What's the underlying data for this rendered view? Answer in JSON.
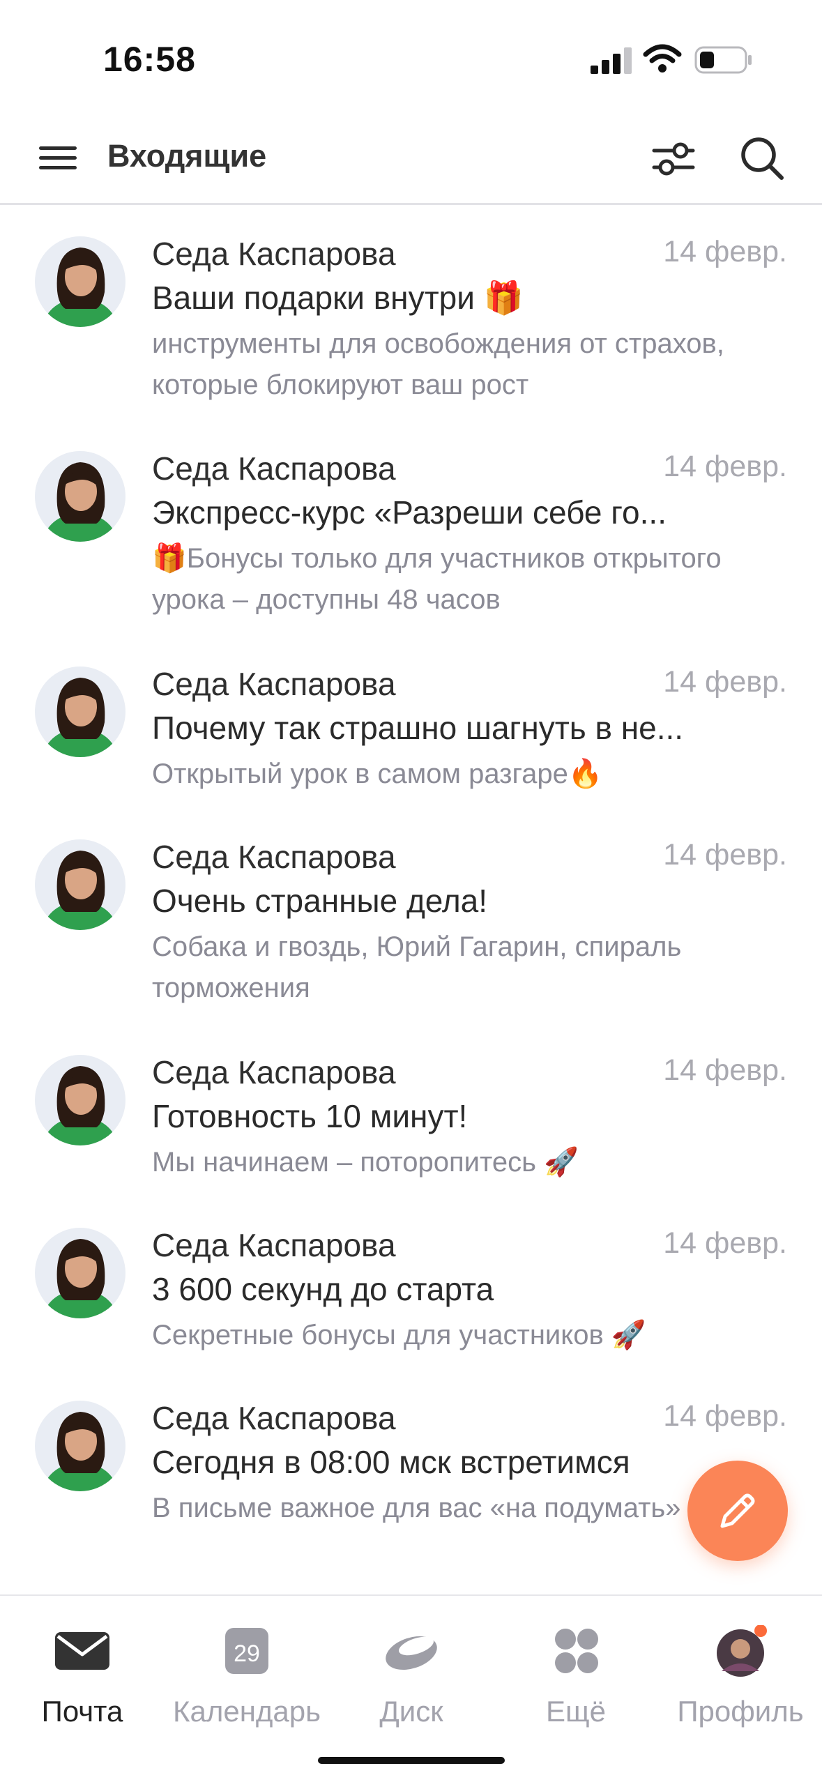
{
  "status_bar": {
    "time": "16:58"
  },
  "header": {
    "title": "Входящие"
  },
  "mails": [
    {
      "sender": "Седа Каспарова",
      "date": "14 февр.",
      "subject": "Ваши подарки внутри 🎁",
      "preview": "инструменты для освобождения от страхов, которые блокируют ваш рост"
    },
    {
      "sender": "Седа Каспарова",
      "date": "14 февр.",
      "subject": "Экспресс-курс «Разреши себе го...",
      "preview": "🎁Бонусы только для участников открытого урока – доступны 48 часов"
    },
    {
      "sender": "Седа Каспарова",
      "date": "14 февр.",
      "subject": "Почему так страшно шагнуть в не...",
      "preview": "Открытый урок в самом разгаре🔥"
    },
    {
      "sender": "Седа Каспарова",
      "date": "14 февр.",
      "subject": "Очень странные дела!",
      "preview": "Собака и гвоздь, Юрий Гагарин, спираль торможения"
    },
    {
      "sender": "Седа Каспарова",
      "date": "14 февр.",
      "subject": "Готовность 10 минут!",
      "preview": "Мы начинаем – поторопитесь 🚀"
    },
    {
      "sender": "Седа Каспарова",
      "date": "14 февр.",
      "subject": "3 600 секунд до старта",
      "preview": "Секретные бонусы для участников 🚀"
    },
    {
      "sender": "Седа Каспарова",
      "date": "14 февр.",
      "subject": "Сегодня в 08:00 мск встретимся",
      "preview": "В письме важное для вас «на подумать»"
    }
  ],
  "bottom_nav": {
    "mail": "Почта",
    "calendar": "Календарь",
    "calendar_day": "29",
    "disk": "Диск",
    "more": "Ещё",
    "profile": "Профиль"
  },
  "colors": {
    "accent": "#fb8557",
    "notification_dot": "#fb6a3a",
    "preview_text": "#8a8a95",
    "date_text": "#a9a9b0",
    "nav_inactive": "#a3a3ad"
  },
  "icons": [
    "menu-icon",
    "filter-icon",
    "search-icon",
    "compose-icon",
    "mail-icon",
    "calendar-icon",
    "disk-icon",
    "more-icon",
    "profile-avatar"
  ]
}
